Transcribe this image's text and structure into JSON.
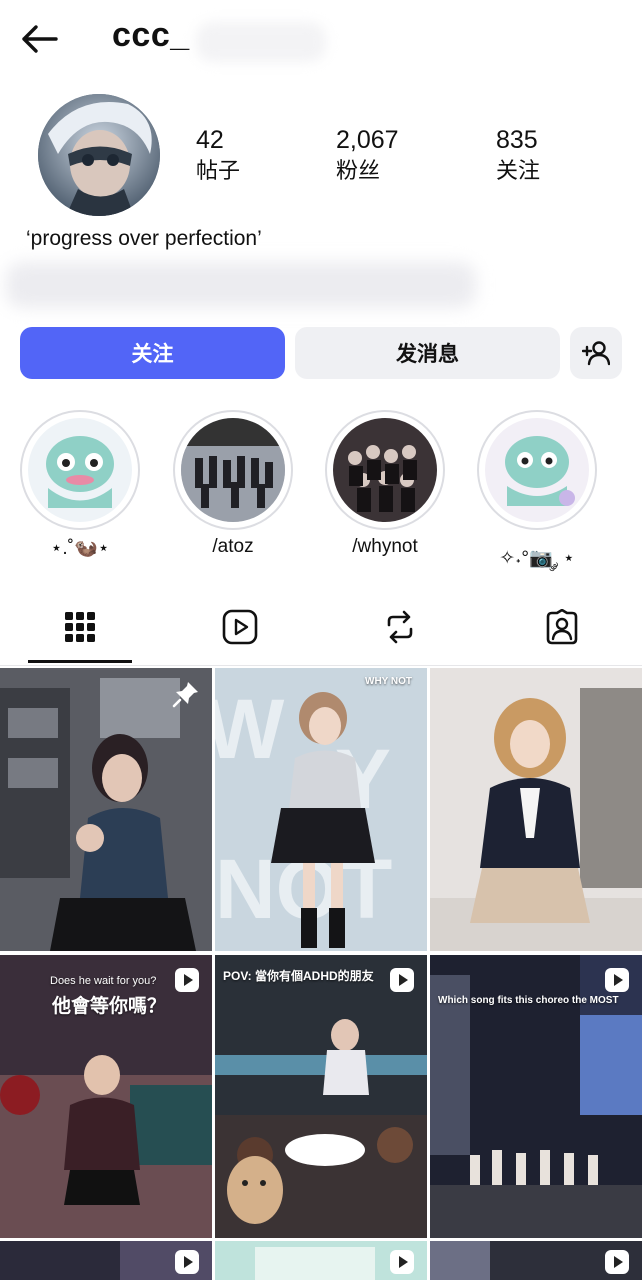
{
  "header": {
    "username": "ccc_"
  },
  "stats": [
    {
      "value": "42",
      "label": "帖子"
    },
    {
      "value": "2,067",
      "label": "粉丝"
    },
    {
      "value": "835",
      "label": "关注"
    }
  ],
  "bio": "‘progress over perfection’",
  "actions": {
    "follow": "关注",
    "message": "发消息"
  },
  "highlights": [
    {
      "label": "⋆.˚🦦⋆"
    },
    {
      "label": "/atoz"
    },
    {
      "label": "/whynot"
    },
    {
      "label": "✧˖°📷 ༘ ⋆"
    }
  ],
  "tabs": [
    "grid-icon",
    "reels-icon",
    "reposts-icon",
    "tagged-icon"
  ],
  "posts": [
    {
      "type": "pinned",
      "caption": ""
    },
    {
      "type": "photo",
      "caption": "WHY NOT"
    },
    {
      "type": "photo",
      "caption": ""
    },
    {
      "type": "reel",
      "caption_top": "Does he wait for you?",
      "caption": "他會等你嗎？"
    },
    {
      "type": "reel",
      "caption": "POV: 當你有個ADHD的朋友"
    },
    {
      "type": "reel",
      "caption": "Which song fits this choreo the MOST"
    }
  ],
  "colors": {
    "accent": "#5265f7",
    "button_bg": "#eff0f3"
  }
}
